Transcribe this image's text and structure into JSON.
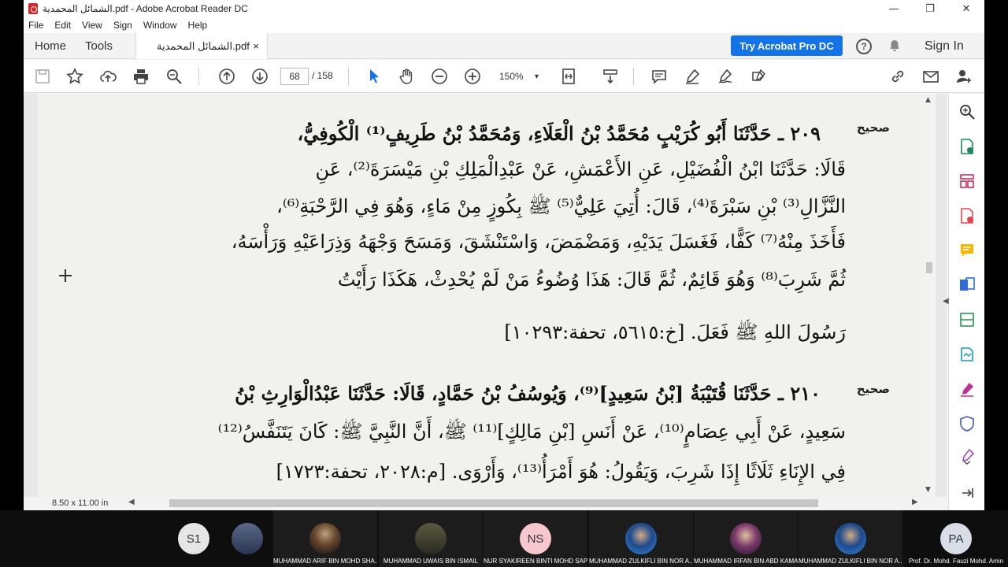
{
  "window": {
    "title": "الشمائل المحمدية.pdf - Adobe Acrobat Reader DC",
    "controls": {
      "minimize": "—",
      "restore": "❐",
      "close": "✕"
    }
  },
  "menu": [
    "File",
    "Edit",
    "View",
    "Sign",
    "Window",
    "Help"
  ],
  "tabs": {
    "home": "Home",
    "tools": "Tools",
    "doc": "الشمائل المحمدية.pdf",
    "doc_close": "×"
  },
  "header_actions": {
    "try_pro": "Try Acrobat Pro DC",
    "help": "?",
    "sign_in": "Sign In"
  },
  "toolbar": {
    "page_current": "68",
    "page_total": "/ 158",
    "zoom": "150%",
    "zoom_caret": "▾"
  },
  "document": {
    "h1_label": "صحيح",
    "h1_lines": [
      "٢٠٩ ـ حَدَّثَنَا أَبُو كُرَيْبٍ مُحَمَّدُ بْنُ الْعَلَاءِ، وَمُحَمَّدُ بْنُ طَرِيفٍ⁽¹⁾ الْكُوفِيُّ،",
      "قَالَا: حَدَّثَنَا ابْنُ الْفُضَيْلِ، عَنِ الأَعْمَشِ، عَنْ عَبْدِالْمَلِكِ بْنِ مَيْسَرَةَ⁽²⁾، عَنِ",
      "النَّزَّالِ⁽³⁾ بْنِ سَبْرَةَ⁽⁴⁾، قَالَ: أُتِيَ عَلِيٌّ⁽⁵⁾ ﷺ بِكُوزٍ مِنْ مَاءٍ، وَهُوَ فِي الرَّحْبَةِ⁽⁶⁾،",
      "فَأَخَذَ مِنْهُ⁽⁷⁾ كَفًّا، فَغَسَلَ يَدَيْهِ، وَمَضْمَضَ، وَاسْتَنْشَقَ، وَمَسَحَ وَجْهَهُ وَذِرَاعَيْهِ وَرَأْسَهُ،",
      "ثُمَّ شَرِبَ⁽⁸⁾ وَهُوَ قَائِمٌ، ثُمَّ قَالَ: هَذَا وُضُوءُ مَنْ لَمْ يُحْدِثْ، هَكَذَا رَأَيْتُ",
      "رَسُولَ اللهِ ﷺ فَعَلَ. [خ:٥٦١٥، تحفة:١٠٢٩٣]"
    ],
    "h2_label": "صحيح",
    "h2_lines": [
      "٢١٠ ـ حَدَّثَنَا قُتَيْبَةُ [بْنُ سَعِيدٍ]⁽⁹⁾، وَيُوسُفُ بْنُ حَمَّادٍ، قَالَا: حَدَّثَنَا عَبْدُالْوَارِثِ بْنُ",
      "سَعِيدٍ، عَنْ أَبِي عِصَامٍ⁽¹⁰⁾، عَنْ أَنَسِ [بْنِ مَالِكٍ]⁽¹¹⁾ ﷺ، أَنَّ النَّبِيَّ ﷺ: كَانَ يَتَنَفَّسُ⁽¹²⁾",
      "فِي الإِنَاءِ ثَلَاثًا إِذَا شَرِبَ، وَيَقُولُ: هُوَ أَمْرَأُ⁽¹³⁾، وَأَرْوَى. [م:٢٠٢٨، تحفة:١٧٢٣]"
    ]
  },
  "statusbar": {
    "page_size": "8.50 x 11.00 in"
  },
  "participants": [
    {
      "initials": "S1",
      "name": "",
      "color": "#e6e6e6"
    },
    {
      "initials": "",
      "name": "",
      "color": "#3a4a6a"
    },
    {
      "initials": "",
      "name": "MUHAMMAD ARIF BIN MOHD SHA...",
      "color": "#4a3a2a"
    },
    {
      "initials": "",
      "name": "MUHAMMAD UWAIS BIN ISMAIL",
      "color": "#3a3a30"
    },
    {
      "initials": "NS",
      "name": "NUR SYAKIREEN BINTI MOHD SAP...",
      "color": "#f6c7cf"
    },
    {
      "initials": "",
      "name": "MUHAMMAD ZULKIFLI BIN NOR A...",
      "color": "#2a6fc0"
    },
    {
      "initials": "",
      "name": "MUHAMMAD IRFAN BIN ABD KAMAL",
      "color": "#7a3a6a"
    },
    {
      "initials": "",
      "name": "MUHAMMAD ZULKIFLI BIN NOR A...",
      "color": "#2a6fc0"
    },
    {
      "initials": "PA",
      "name": "Prof. Dr. Mohd. Fauzi Mohd. Amin",
      "color": "#d9dde8"
    }
  ]
}
